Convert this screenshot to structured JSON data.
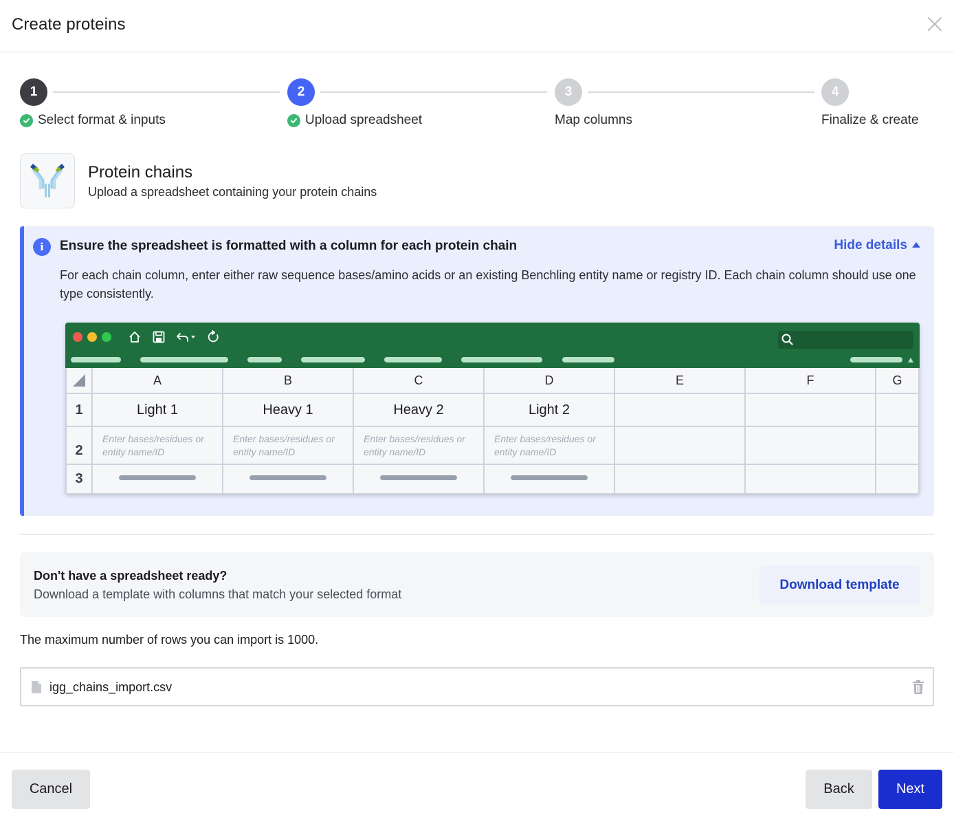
{
  "dialog": {
    "title": "Create proteins",
    "close_icon": "close-icon"
  },
  "stepper": {
    "steps": [
      {
        "number": "1",
        "label": "Select format & inputs",
        "state": "complete",
        "color": "#3d3e44"
      },
      {
        "number": "2",
        "label": "Upload spreadsheet",
        "state": "current",
        "color": "#4563f5"
      },
      {
        "number": "3",
        "label": "Map columns",
        "state": "upcoming",
        "color": "#cfd1d5"
      },
      {
        "number": "4",
        "label": "Finalize & create",
        "state": "upcoming",
        "color": "#cfd1d5"
      }
    ],
    "check_color": "#3bb872"
  },
  "format": {
    "icon": "antibody-icon",
    "title": "Protein chains",
    "subtitle": "Upload a spreadsheet containing your protein chains"
  },
  "callout": {
    "icon": "info-icon",
    "heading": "Ensure the spreadsheet is formatted with a column for each protein chain",
    "toggle_label": "Hide details",
    "description": "For each chain column, enter either raw sequence bases/amino acids or an existing Benchling entity name or registry ID. Each chain column should use one type consistently.",
    "accent": "#4a6cf7"
  },
  "spreadsheet": {
    "columns": [
      "A",
      "B",
      "C",
      "D",
      "E",
      "F",
      "G"
    ],
    "rows": [
      "1",
      "2",
      "3"
    ],
    "header_values": [
      "Light 1",
      "Heavy 1",
      "Heavy 2",
      "Light 2"
    ],
    "placeholder": "Enter bases/residues or entity name/ID",
    "toolbar_color": "#1f6e3e"
  },
  "template": {
    "title": "Don't have a spreadsheet ready?",
    "subtitle": "Download a template with columns that match your selected format",
    "button_label": "Download template"
  },
  "limits": {
    "max_rows_text": "The maximum number of rows you can import is 1000."
  },
  "upload": {
    "file_icon": "file-icon",
    "filename": "igg_chains_import.csv",
    "delete_icon": "trash-icon"
  },
  "footer": {
    "cancel_label": "Cancel",
    "back_label": "Back",
    "next_label": "Next",
    "primary_color": "#1a2ecf"
  }
}
